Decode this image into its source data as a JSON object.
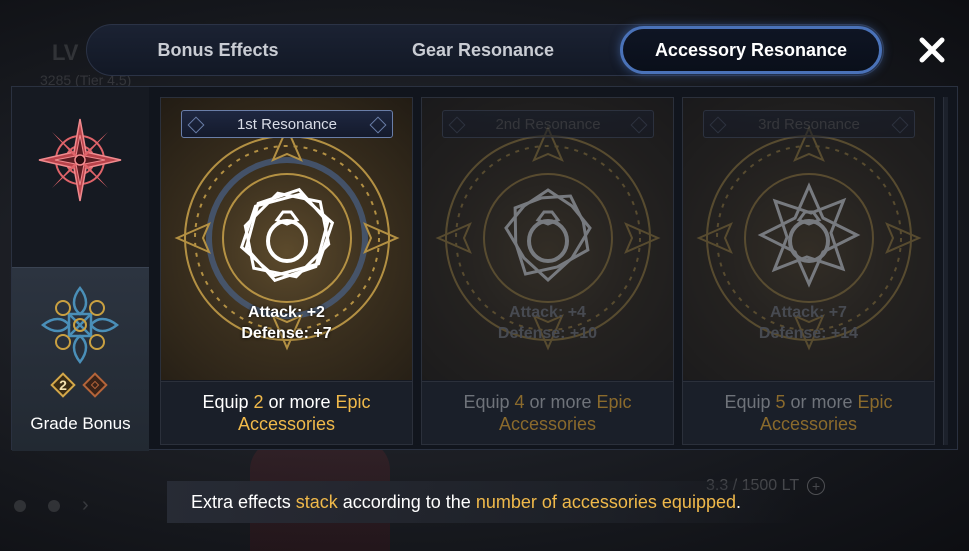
{
  "background": {
    "level_label": "LV",
    "combat_power": "3285 (Tier 4.5)",
    "weight": "3.3 / 1500 LT"
  },
  "tabs": [
    {
      "label": "Bonus Effects",
      "active": false
    },
    {
      "label": "Gear Resonance",
      "active": false
    },
    {
      "label": "Accessory Resonance",
      "active": true
    }
  ],
  "sidebar": {
    "grade_bonus_label": "Grade Bonus",
    "badge_number": "2"
  },
  "cards": [
    {
      "title": "1st Resonance",
      "attack": "Attack: +2",
      "defense": "Defense: +7",
      "req_prefix": "Equip ",
      "req_count": "2",
      "req_mid": " or more ",
      "req_grade": "Epic",
      "req_suffix": "Accessories",
      "active": true
    },
    {
      "title": "2nd Resonance",
      "attack": "Attack: +4",
      "defense": "Defense: +10",
      "req_prefix": "Equip ",
      "req_count": "4",
      "req_mid": " or more ",
      "req_grade": "Epic",
      "req_suffix": "Accessories",
      "active": false
    },
    {
      "title": "3rd Resonance",
      "attack": "Attack: +7",
      "defense": "Defense: +14",
      "req_prefix": "Equip ",
      "req_count": "5",
      "req_mid": " or more ",
      "req_grade": "Epic",
      "req_suffix": "Accessories",
      "active": false
    }
  ],
  "note": {
    "part1": "Extra effects ",
    "hl1": "stack",
    "part2": " according to the ",
    "hl2": "number of accessories equipped",
    "part3": "."
  },
  "colors": {
    "highlight": "#f0b94a",
    "active_tab_border": "#4a72b8"
  },
  "icons": [
    "close-icon",
    "compass-star-icon",
    "celtic-cross-icon",
    "ring-icon"
  ]
}
